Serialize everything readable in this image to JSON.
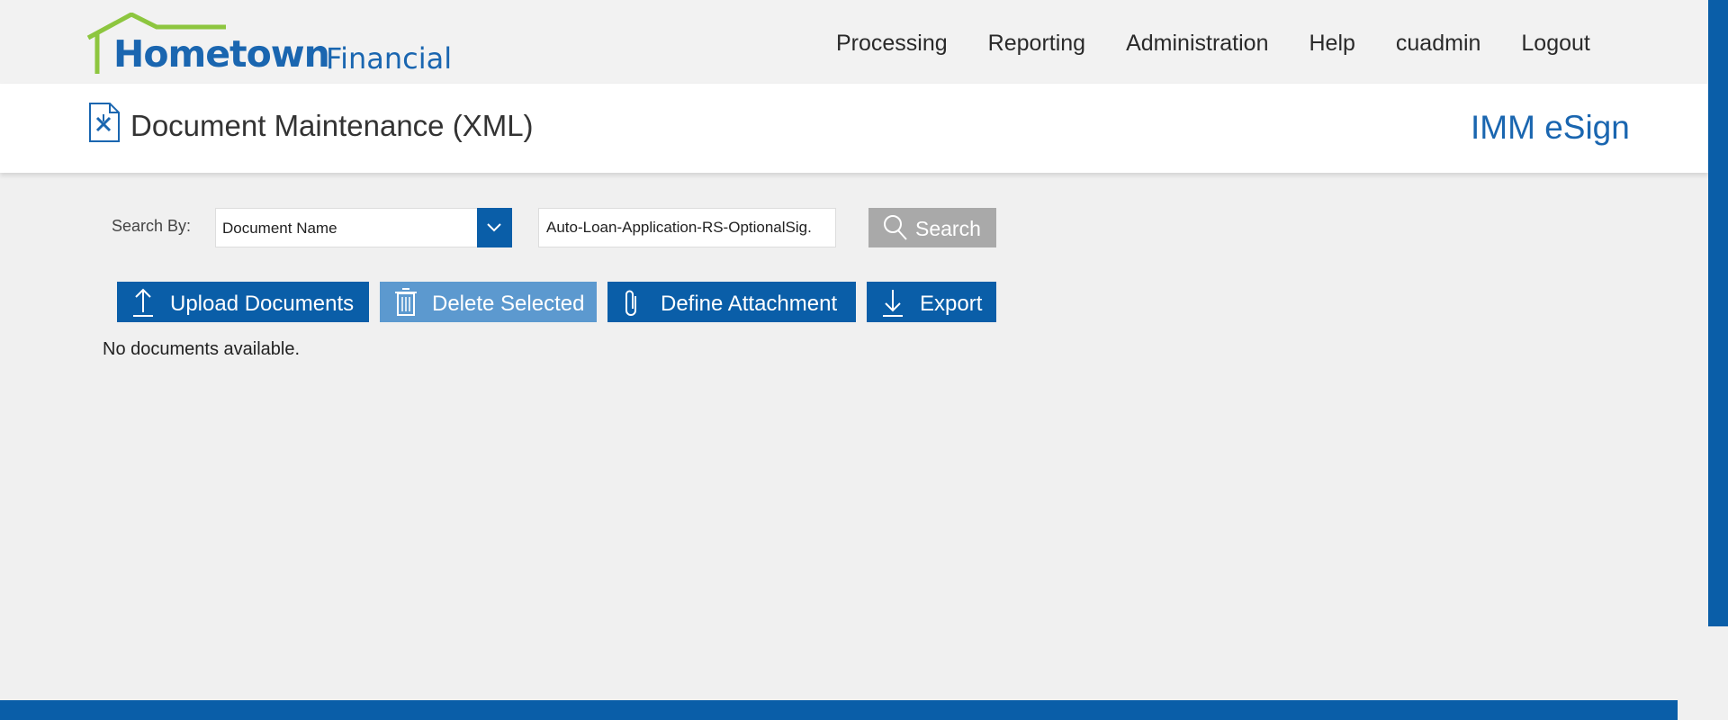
{
  "brand": {
    "name": "Hometown",
    "sub": "Financial",
    "colors": {
      "logo_roof": "#8dc63f",
      "logo_text": "#1a66b0"
    }
  },
  "nav": {
    "items": [
      "Processing",
      "Reporting",
      "Administration",
      "Help",
      "cuadmin",
      "Logout"
    ]
  },
  "page": {
    "title": "Document Maintenance (XML)",
    "app_name": "IMM eSign",
    "title_icon": "document-tools-icon"
  },
  "search": {
    "label": "Search By:",
    "selected_option": "Document Name",
    "value": "Auto-Loan-Application-RS-OptionalSig.",
    "button_label": "Search",
    "icon": "search-icon"
  },
  "actions": {
    "upload": {
      "label": "Upload Documents",
      "icon": "upload-arrow-icon"
    },
    "delete": {
      "label": "Delete Selected",
      "icon": "trash-icon",
      "disabled": true
    },
    "attach": {
      "label": "Define Attachment",
      "icon": "paperclip-icon"
    },
    "export": {
      "label": "Export",
      "icon": "download-arrow-icon"
    }
  },
  "results": {
    "empty_message": "No documents available."
  },
  "theme": {
    "primary": "#0a5ea8",
    "disabled": "#5c99cf",
    "search_button": "#a9a9a9",
    "background": "#f0f0f0"
  }
}
